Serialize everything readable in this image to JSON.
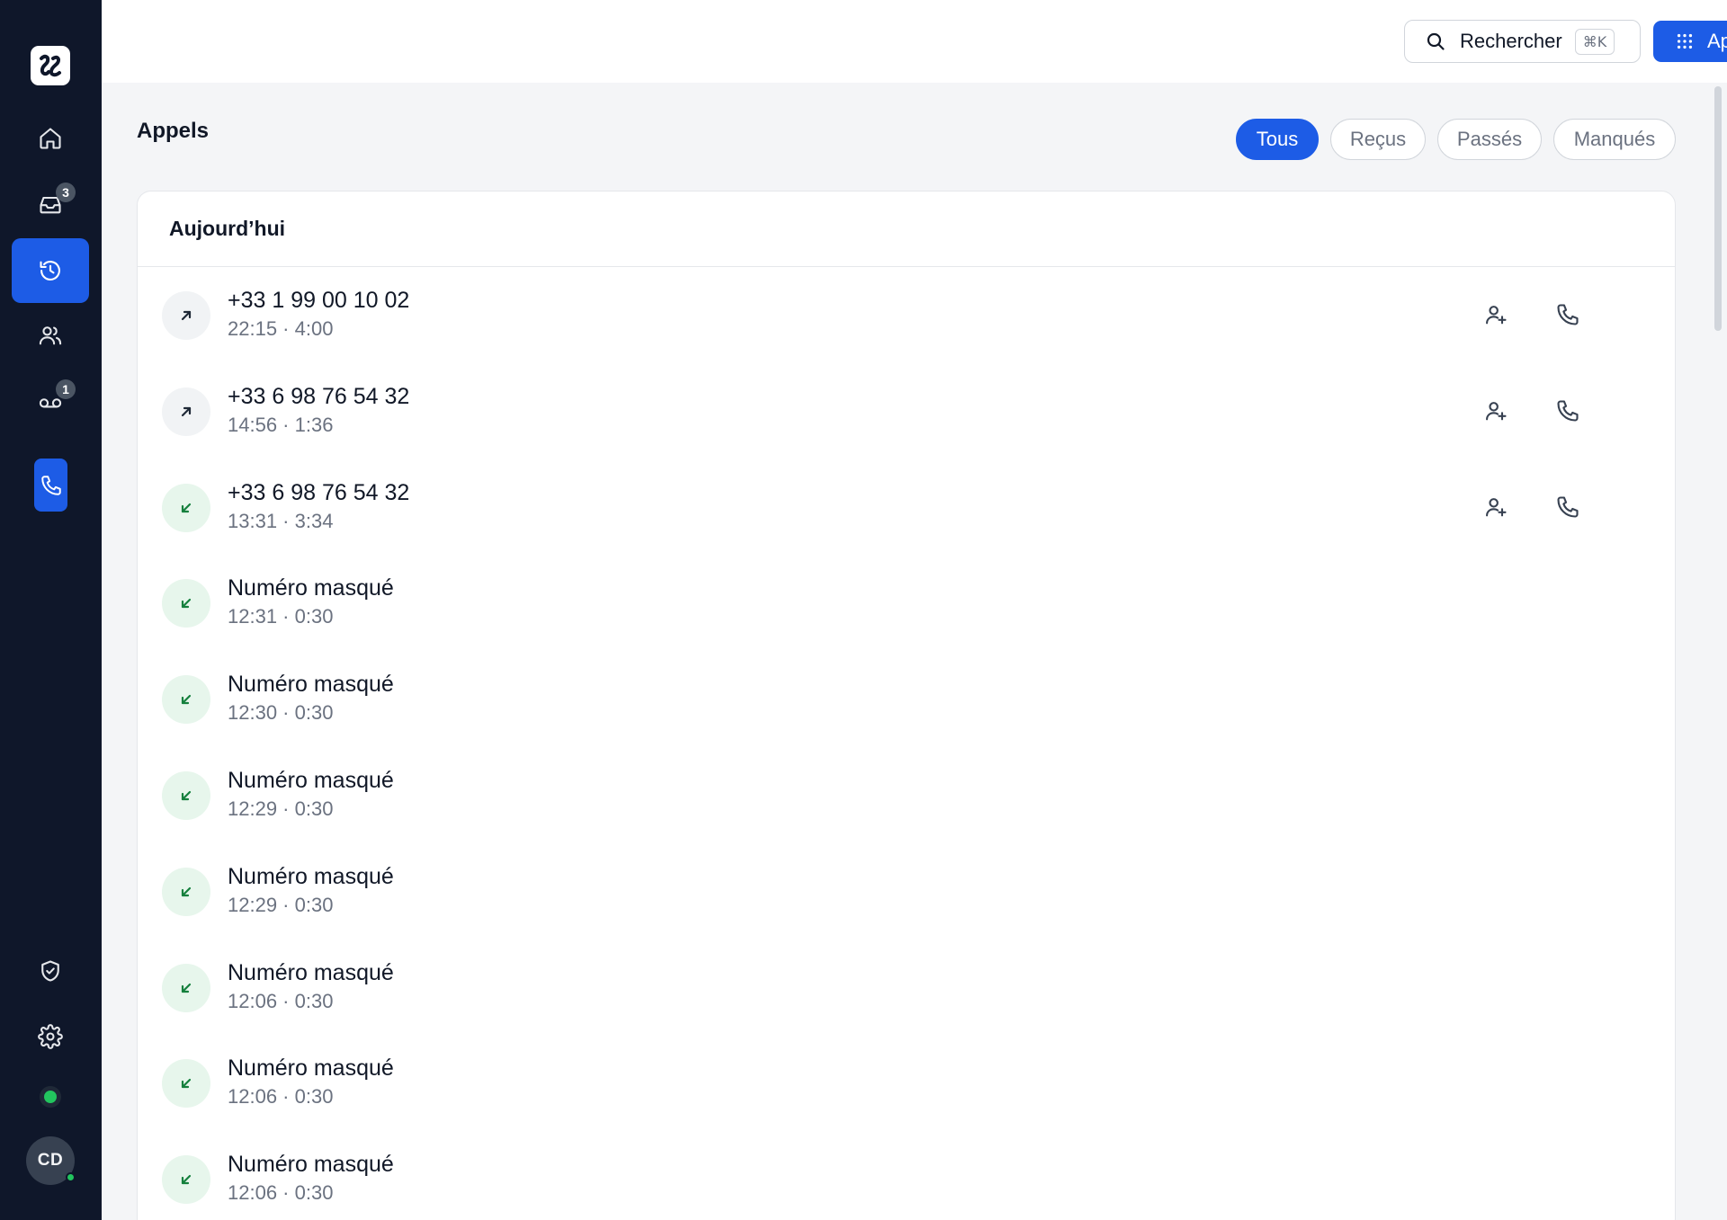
{
  "sidebar": {
    "logo": "app-logo",
    "items": [
      {
        "name": "home-icon",
        "badge": ""
      },
      {
        "name": "inbox-icon",
        "badge": "3"
      },
      {
        "name": "history-icon",
        "badge": "",
        "active": true
      },
      {
        "name": "contacts-icon",
        "badge": ""
      },
      {
        "name": "voicemail-icon",
        "badge": "1"
      }
    ],
    "avatar_initials": "CD"
  },
  "topbar": {
    "search_label": "Rechercher",
    "search_shortcut": "⌘K",
    "call_label": "Appeler"
  },
  "page": {
    "title": "Appels",
    "filters": [
      "Tous",
      "Reçus",
      "Passés",
      "Manqués"
    ],
    "active_filter": "Tous"
  },
  "calls": {
    "section_title": "Aujourd’hui",
    "rows": [
      {
        "direction": "outgoing",
        "name": "+33 1 99 00 10 02",
        "meta": "22:15 · 4:00",
        "actions": true
      },
      {
        "direction": "outgoing",
        "name": "+33 6 98 76 54 32",
        "meta": "14:56 · 1:36",
        "actions": true
      },
      {
        "direction": "incoming",
        "name": "+33 6 98 76 54 32",
        "meta": "13:31 · 3:34",
        "actions": true
      },
      {
        "direction": "incoming",
        "name": "Numéro masqué",
        "meta": "12:31 · 0:30",
        "actions": false
      },
      {
        "direction": "incoming",
        "name": "Numéro masqué",
        "meta": "12:30 · 0:30",
        "actions": false
      },
      {
        "direction": "incoming",
        "name": "Numéro masqué",
        "meta": "12:29 · 0:30",
        "actions": false
      },
      {
        "direction": "incoming",
        "name": "Numéro masqué",
        "meta": "12:29 · 0:30",
        "actions": false
      },
      {
        "direction": "incoming",
        "name": "Numéro masqué",
        "meta": "12:06 · 0:30",
        "actions": false
      },
      {
        "direction": "incoming",
        "name": "Numéro masqué",
        "meta": "12:06 · 0:30",
        "actions": false
      },
      {
        "direction": "incoming",
        "name": "Numéro masqué",
        "meta": "12:06 · 0:30",
        "actions": false
      }
    ]
  },
  "colors": {
    "accent": "#1d5ce6",
    "sidebar": "#0f172a",
    "incoming": "#15803d",
    "online": "#22c55e"
  }
}
